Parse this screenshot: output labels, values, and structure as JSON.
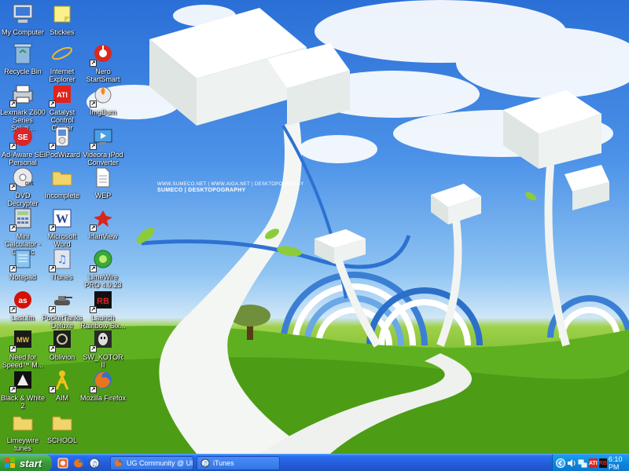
{
  "desktop": {
    "wallpaper_caption": "WWW.SUMECO.NET | WWW.AIGA.NET | DESKTOPOGRAPHY",
    "wallpaper_title": "SUMECO | DESKTOPOGRAPHY",
    "icons": [
      {
        "label": "My Computer",
        "icon": "computer-icon"
      },
      {
        "label": "Stickies",
        "icon": "stickies-icon"
      },
      {
        "label": "Recycle Bin",
        "icon": "recycle-bin-icon"
      },
      {
        "label": "Internet Explorer",
        "icon": "internet-explorer-icon"
      },
      {
        "label": "Nero StartSmart",
        "icon": "nero-icon"
      },
      {
        "label": "Lexmark Z600 Series Soluti...",
        "icon": "printer-icon"
      },
      {
        "label": "Catalyst Control Center",
        "icon": "ati-icon"
      },
      {
        "label": "ImgBurn",
        "icon": "imgburn-icon"
      },
      {
        "label": "Ad-Aware SE Personal",
        "icon": "adaware-icon"
      },
      {
        "label": "iPodWizard",
        "icon": "ipodwizard-icon"
      },
      {
        "label": "Videora iPod Converter",
        "icon": "videora-icon"
      },
      {
        "label": "DVD Decrypter",
        "icon": "dvd-icon"
      },
      {
        "label": "Incomplete",
        "icon": "folder-icon"
      },
      {
        "label": "WEP",
        "icon": "document-icon"
      },
      {
        "label": "Mini Calculator - Classic",
        "icon": "calculator-icon"
      },
      {
        "label": "Microsoft Word",
        "icon": "word-icon"
      },
      {
        "label": "IrfanView",
        "icon": "irfanview-icon"
      },
      {
        "label": "Notepad",
        "icon": "notepad-icon"
      },
      {
        "label": "iTunes",
        "icon": "itunes-icon"
      },
      {
        "label": "LimeWire PRO 4.9.23",
        "icon": "limewire-icon"
      },
      {
        "label": "Last.fm",
        "icon": "lastfm-icon"
      },
      {
        "label": "PocketTanks Deluxe",
        "icon": "tank-icon"
      },
      {
        "label": "Launch Rainbow Six...",
        "icon": "rainbow-six-icon"
      },
      {
        "label": "Need for Speed™ M...",
        "icon": "nfs-icon"
      },
      {
        "label": "Oblivion",
        "icon": "oblivion-icon"
      },
      {
        "label": "SW_KOTOR II",
        "icon": "kotor-icon"
      },
      {
        "label": "Black & White 2",
        "icon": "black-white-icon"
      },
      {
        "label": "AIM",
        "icon": "aim-icon"
      },
      {
        "label": "Mozilla Firefox",
        "icon": "firefox-icon"
      },
      {
        "label": "Limeywire tunes",
        "icon": "folder-icon"
      },
      {
        "label": "SCHOOL",
        "icon": "folder-icon"
      }
    ]
  },
  "taskbar": {
    "start_label": "start",
    "quick_launch": [
      "media-icon",
      "firefox-icon",
      "itunes-icon"
    ],
    "tasks": [
      {
        "label": "UG Community @ Ulti...",
        "icon": "firefox-icon"
      },
      {
        "label": "iTunes",
        "icon": "itunes-icon"
      }
    ],
    "tray": {
      "icons": [
        "chevron-left-icon",
        "volume-icon",
        "network-icon",
        "ati-tray-icon",
        "rainbow-tray-icon"
      ],
      "ati_label": "ATI",
      "rb_label": "RB",
      "clock": "6:10 PM"
    }
  },
  "colors": {
    "taskbar": "#245edc",
    "start": "#3a9b3a",
    "tray": "#0f84dc"
  }
}
